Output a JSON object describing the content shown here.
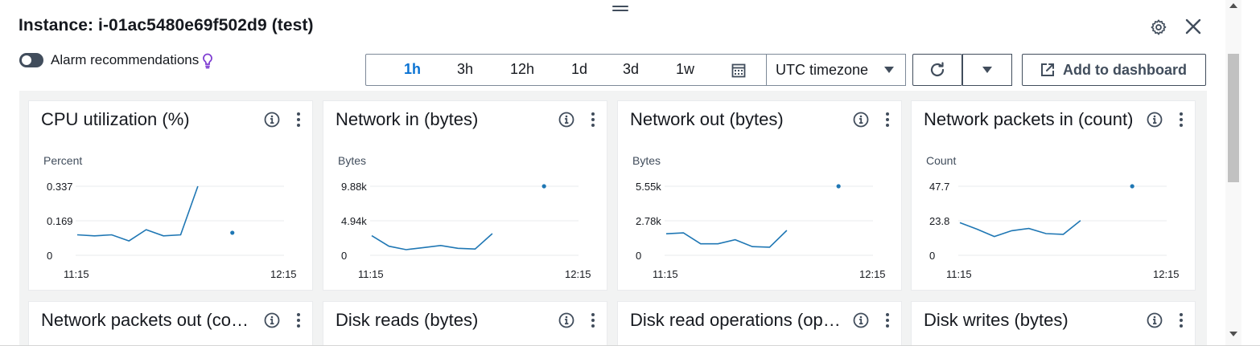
{
  "header": {
    "title": "Instance: i-01ac5480e69f502d9 (test)"
  },
  "alarm": {
    "label": "Alarm recommendations",
    "enabled": false
  },
  "time_range": {
    "options": [
      "1h",
      "3h",
      "12h",
      "1d",
      "3d",
      "1w"
    ],
    "selected": "1h",
    "timezone": "UTC timezone"
  },
  "actions": {
    "add_to_dashboard": "Add to dashboard"
  },
  "colors": {
    "accent": "#0972d3",
    "series": "#1f77b4"
  },
  "widgets": [
    {
      "title": "CPU utilization (%)",
      "chart_data": {
        "type": "line",
        "ylabel": "Percent",
        "y_ticks": [
          "0.337",
          "0.169",
          "0"
        ],
        "ylim": [
          0,
          0.337
        ],
        "x_ticks": [
          "11:15",
          "12:15"
        ],
        "x": [
          "11:15",
          "11:20",
          "11:25",
          "11:30",
          "11:35",
          "11:40",
          "11:45",
          "11:50"
        ],
        "values": [
          0.1,
          0.095,
          0.1,
          0.07,
          0.125,
          0.095,
          0.1,
          0.337
        ],
        "isolated_point": {
          "x": "12:00",
          "value": 0.11
        }
      }
    },
    {
      "title": "Network in (bytes)",
      "chart_data": {
        "type": "line",
        "ylabel": "Bytes",
        "y_ticks": [
          "9.88k",
          "4.94k",
          "0"
        ],
        "ylim": [
          0,
          9880
        ],
        "x_ticks": [
          "11:15",
          "12:15"
        ],
        "x": [
          "11:15",
          "11:20",
          "11:25",
          "11:30",
          "11:35",
          "11:40",
          "11:45",
          "11:50"
        ],
        "values": [
          2800,
          1300,
          800,
          1100,
          1400,
          1000,
          900,
          3100
        ],
        "isolated_point": {
          "x": "12:05",
          "value": 9880
        }
      }
    },
    {
      "title": "Network out (bytes)",
      "chart_data": {
        "type": "line",
        "ylabel": "Bytes",
        "y_ticks": [
          "5.55k",
          "2.78k",
          "0"
        ],
        "ylim": [
          0,
          5550
        ],
        "x_ticks": [
          "11:15",
          "12:15"
        ],
        "x": [
          "11:15",
          "11:20",
          "11:25",
          "11:30",
          "11:35",
          "11:40",
          "11:45",
          "11:50"
        ],
        "values": [
          1730,
          1800,
          920,
          920,
          1250,
          700,
          650,
          2000
        ],
        "isolated_point": {
          "x": "12:05",
          "value": 5550
        }
      }
    },
    {
      "title": "Network packets in (count)",
      "chart_data": {
        "type": "line",
        "ylabel": "Count",
        "y_ticks": [
          "47.7",
          "23.8",
          "0"
        ],
        "ylim": [
          0,
          47.7
        ],
        "x_ticks": [
          "11:15",
          "12:15"
        ],
        "x": [
          "11:15",
          "11:20",
          "11:25",
          "11:30",
          "11:35",
          "11:40",
          "11:45",
          "11:50"
        ],
        "values": [
          22.5,
          18,
          13,
          17,
          18.5,
          15,
          14.5,
          24
        ],
        "isolated_point": {
          "x": "12:05",
          "value": 47.7
        }
      }
    },
    {
      "title": "Network packets out (count)"
    },
    {
      "title": "Disk reads (bytes)"
    },
    {
      "title": "Disk read operations (operations)"
    },
    {
      "title": "Disk writes (bytes)"
    }
  ]
}
